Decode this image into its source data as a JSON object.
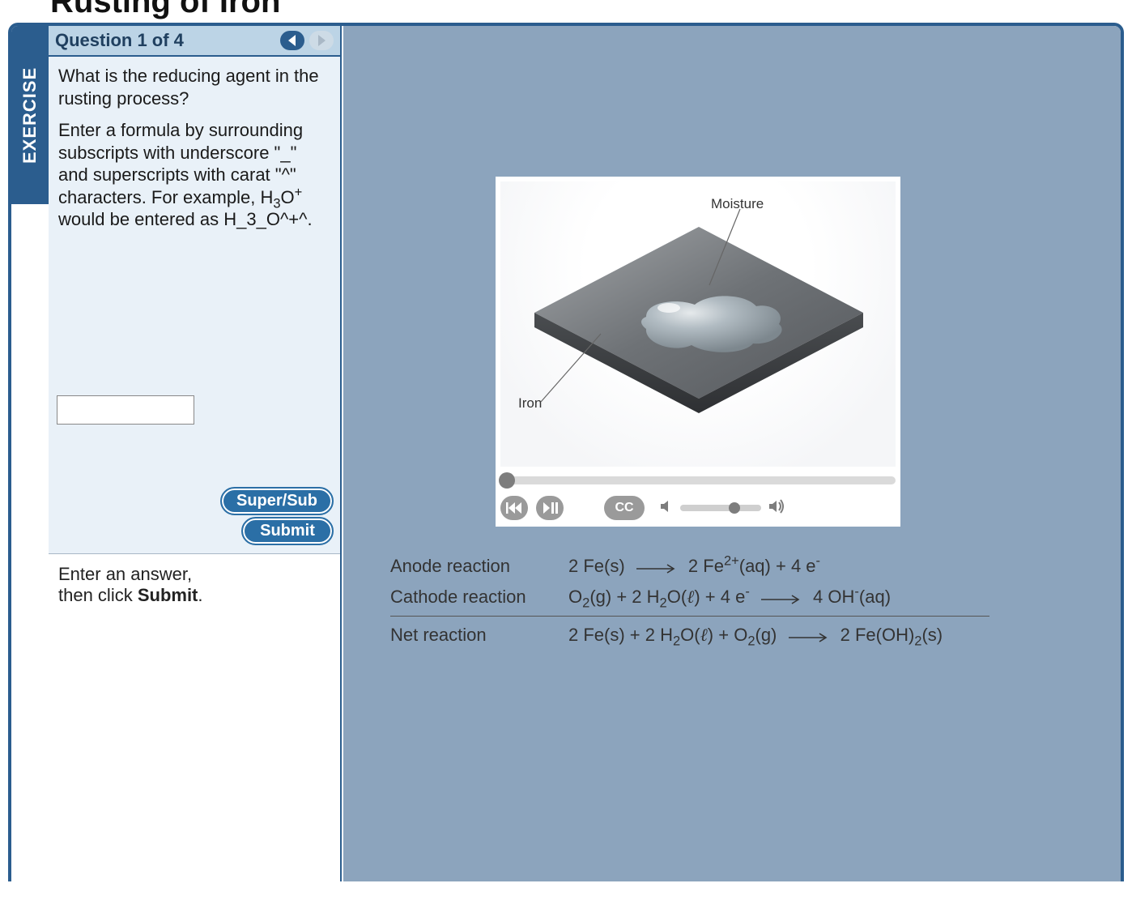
{
  "page": {
    "title": "Rusting of Iron"
  },
  "sidebar": {
    "label": "EXERCISE"
  },
  "question": {
    "header": "Question 1 of 4",
    "prompt": "What is the reducing agent in the rusting process?",
    "hint_line1": "Enter a formula by surrounding subscripts with underscore \"_\" and superscripts with carat \"^\" characters. For example,",
    "hint_line2_pre": "H",
    "hint_line2_sub": "3",
    "hint_line2_mid": "O",
    "hint_line2_sup": "+",
    "hint_line2_post": " would be entered as H_3_O^+^.",
    "answer_value": "",
    "super_sub_btn": "Super/Sub",
    "submit_btn": "Submit"
  },
  "status": {
    "line1": "Enter an answer,",
    "line2_pre": "then click ",
    "line2_bold": "Submit",
    "line2_post": "."
  },
  "media": {
    "label_moisture": "Moisture",
    "label_iron": "Iron",
    "cc_label": "CC",
    "seek_percent": 0,
    "volume_percent": 60
  },
  "reactions": {
    "anode_label": "Anode reaction",
    "cathode_label": "Cathode reaction",
    "net_label": "Net reaction"
  }
}
